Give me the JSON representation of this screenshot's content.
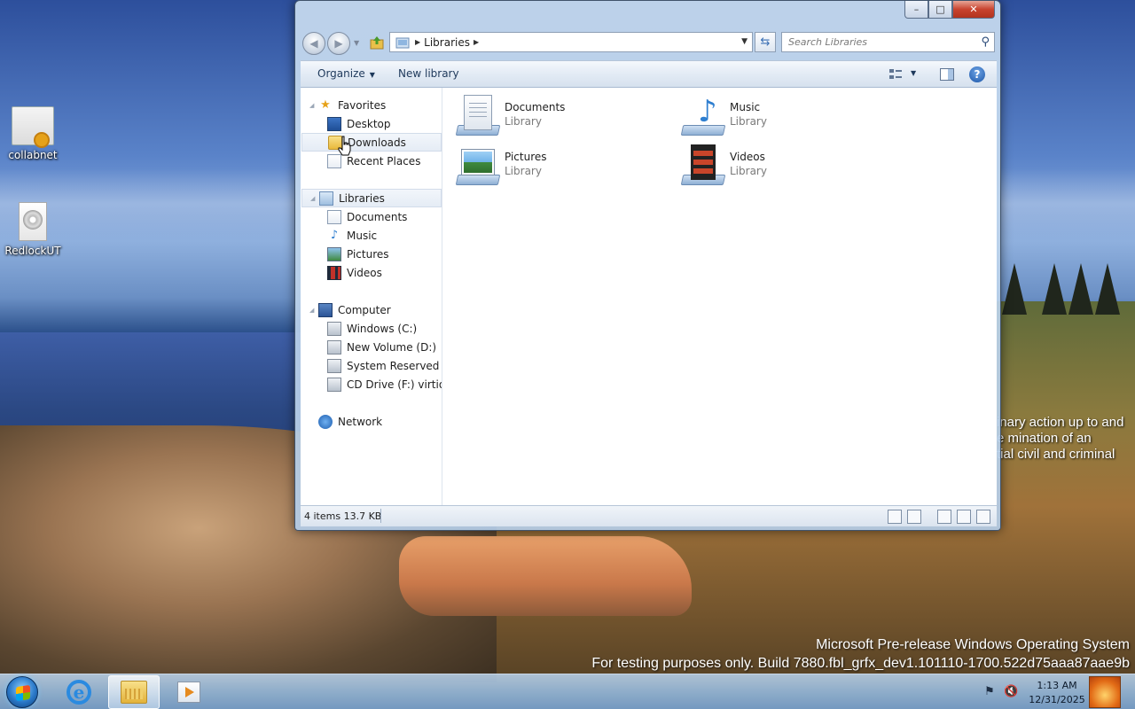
{
  "desktop": {
    "icons": [
      {
        "label": "collabnet",
        "icon": "certificate-icon"
      },
      {
        "label": "RedlockUT",
        "icon": "disc-file-icon"
      }
    ],
    "background_text": [
      "inary action up to and",
      "e mination of an",
      "tial civil and criminal"
    ],
    "watermark": {
      "line1": "Microsoft Pre-release Windows Operating System",
      "line2": "For testing purposes only. Build 7880.fbl_grfx_dev1.101110-1700.522d75aaa87aae9b"
    }
  },
  "window": {
    "caption_buttons": {
      "minimize": "–",
      "maximize": "□",
      "close": "✕"
    },
    "address": {
      "segments": [
        "Libraries"
      ]
    },
    "search": {
      "placeholder": "Search Libraries"
    },
    "toolbar": {
      "organize": "Organize",
      "new_library": "New library"
    },
    "nav": {
      "favorites": {
        "label": "Favorites",
        "items": [
          "Desktop",
          "Downloads",
          "Recent Places"
        ]
      },
      "libraries": {
        "label": "Libraries",
        "items": [
          "Documents",
          "Music",
          "Pictures",
          "Videos"
        ]
      },
      "computer": {
        "label": "Computer",
        "items": [
          "Windows (C:)",
          "New Volume (D:)",
          "System Reserved (E:)",
          "CD Drive (F:) virtio-win"
        ]
      },
      "network": {
        "label": "Network"
      }
    },
    "libraries": [
      {
        "name": "Documents",
        "type": "Library",
        "icon": "documents-library-icon"
      },
      {
        "name": "Music",
        "type": "Library",
        "icon": "music-library-icon"
      },
      {
        "name": "Pictures",
        "type": "Library",
        "icon": "pictures-library-icon"
      },
      {
        "name": "Videos",
        "type": "Library",
        "icon": "videos-library-icon"
      }
    ],
    "status": {
      "items_text": "4 items  13.7 KB"
    }
  },
  "taskbar": {
    "apps": [
      "internet-explorer",
      "windows-explorer",
      "windows-media-player"
    ],
    "clock": {
      "time": "1:13 AM",
      "date": "12/31/2025"
    }
  }
}
